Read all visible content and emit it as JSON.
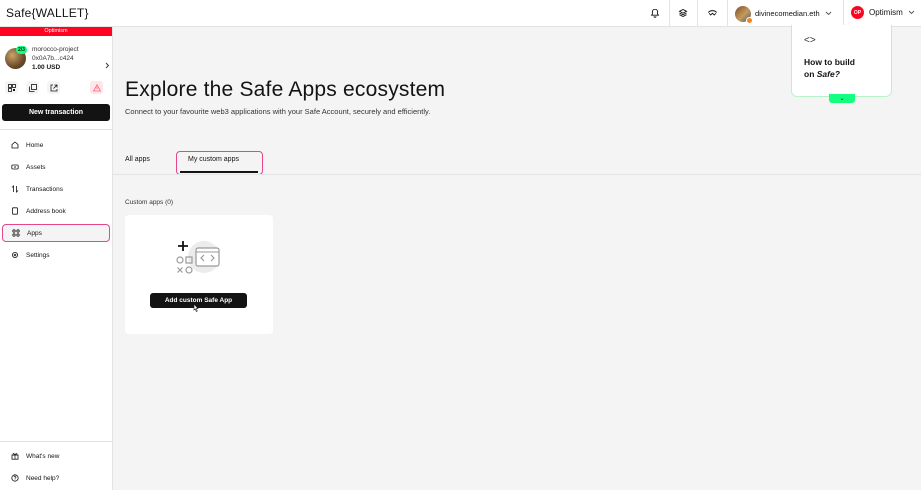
{
  "header": {
    "brand": "Safe{WALLET}",
    "account_name": "divinecomedian.eth",
    "network_badge": "OP",
    "network_name": "Optimism"
  },
  "sidebar": {
    "chain_label": "Optimism",
    "threshold": "2/3",
    "safe_name": "morocco-project",
    "safe_address": "0x0A7b...c424",
    "safe_balance": "1.00 USD",
    "new_transaction": "New transaction",
    "nav": [
      {
        "label": "Home",
        "icon": "home-icon"
      },
      {
        "label": "Assets",
        "icon": "assets-icon"
      },
      {
        "label": "Transactions",
        "icon": "transactions-icon"
      },
      {
        "label": "Address book",
        "icon": "address-book-icon"
      },
      {
        "label": "Apps",
        "icon": "apps-icon",
        "active": true
      },
      {
        "label": "Settings",
        "icon": "settings-icon"
      }
    ],
    "footer": [
      {
        "label": "What's new",
        "icon": "gift-icon"
      },
      {
        "label": "Need help?",
        "icon": "help-icon"
      }
    ]
  },
  "main": {
    "title": "Explore the Safe Apps ecosystem",
    "subtitle": "Connect to your favourite web3 applications with your Safe Account, securely and efficiently.",
    "tabs": [
      {
        "label": "All apps"
      },
      {
        "label": "My custom apps",
        "active": true
      }
    ],
    "custom_apps_label": "Custom apps (0)",
    "add_button": "Add custom Safe App"
  },
  "promo": {
    "code_glyph": "<>",
    "text_line1": "How to build",
    "text_line2_prefix": "on ",
    "text_line2_em": "Safe?",
    "close_glyph": "⌄"
  },
  "colors": {
    "accent_highlight": "#e4478a",
    "brand_green": "#12ff80",
    "optimism_red": "#ff0420"
  }
}
